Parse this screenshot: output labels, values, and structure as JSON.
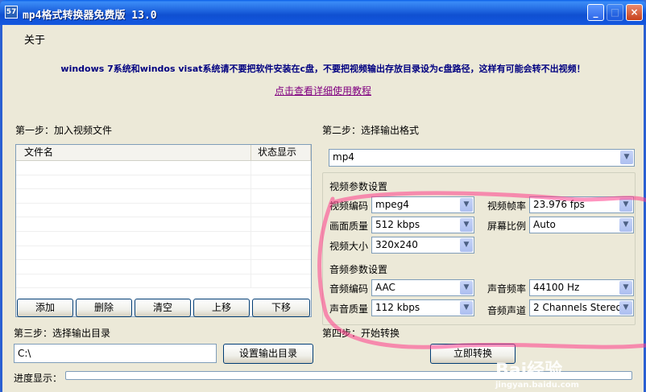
{
  "window": {
    "icon_text": "57",
    "title": "mp4格式转换器免费版 13.0",
    "minimize": "_",
    "maximize": "□",
    "close": "×"
  },
  "menu": {
    "about": "关于"
  },
  "notice": {
    "warning": "windows 7系统和windos visat系统请不要把软件安装在c盘，不要把视频输出存放目录设为c盘路径，这样有可能会转不出视频！",
    "tutorial_link": "点击查看详细使用教程"
  },
  "step1": {
    "label": "第一步：加入视频文件",
    "columns": [
      "文件名",
      "状态显示"
    ],
    "rows": [],
    "buttons": {
      "add": "添加",
      "delete": "删除",
      "clear": "清空",
      "up": "上移",
      "down": "下移"
    }
  },
  "step2": {
    "label": "第二步：选择输出格式",
    "format": "mp4",
    "video_group_label": "视频参数设置",
    "video": {
      "codec_label": "视频编码",
      "codec": "mpeg4",
      "fps_label": "视频帧率",
      "fps": "23.976 fps",
      "quality_label": "画面质量",
      "quality": "512 kbps",
      "aspect_label": "屏幕比例",
      "aspect": "Auto",
      "size_label": "视频大小",
      "size": "320x240"
    },
    "audio_group_label": "音频参数设置",
    "audio": {
      "codec_label": "音频编码",
      "codec": "AAC",
      "rate_label": "声音频率",
      "rate": "44100 Hz",
      "quality_label": "声音质量",
      "quality": "112 kbps",
      "channels_label": "音频声道",
      "channels": "2 Channels Stereo"
    }
  },
  "step3": {
    "label": "第三步：选择输出目录",
    "path": "C:\\",
    "set_button": "设置输出目录"
  },
  "step4": {
    "label": "第四步：开始转换",
    "convert_button": "立即转换"
  },
  "progress": {
    "label": "进度显示：",
    "value_percent": 0
  },
  "watermark": {
    "brand": "Bai经验",
    "url": "jingyan.baidu.com"
  },
  "colors": {
    "title_bar": "#0f4fd1",
    "warning_text": "#000080",
    "link_text": "#800080",
    "highlight": "#ff3d8a"
  }
}
